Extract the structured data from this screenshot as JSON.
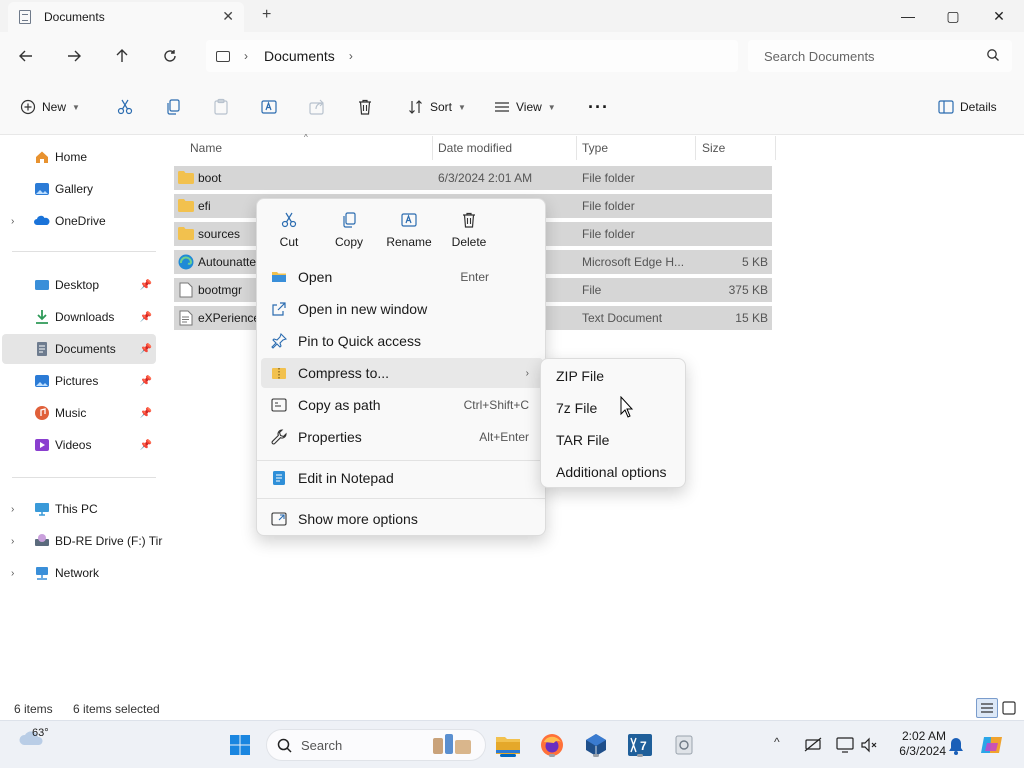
{
  "window": {
    "tab_title": "Documents",
    "new_tab": "+",
    "minimize": "—",
    "maximize": "▢",
    "close": "✕"
  },
  "address": {
    "crumb": "Documents",
    "separator": "›",
    "search_placeholder": "Search Documents"
  },
  "toolbar": {
    "new_label": "New",
    "sort_label": "Sort",
    "view_label": "View",
    "more_label": "···",
    "details_label": "Details"
  },
  "sidebar": {
    "quick": [
      {
        "label": "Home",
        "icon": "home-icon",
        "color": "#e8922f"
      },
      {
        "label": "Gallery",
        "icon": "gallery-icon",
        "color": "#2b7bd6"
      },
      {
        "label": "OneDrive",
        "icon": "onedrive-icon",
        "color": "#1a73d9"
      }
    ],
    "pinned": [
      {
        "label": "Desktop",
        "icon": "desktop-icon",
        "color": "#3a8fd9"
      },
      {
        "label": "Downloads",
        "icon": "downloads-icon",
        "color": "#2e9a58"
      },
      {
        "label": "Documents",
        "icon": "documents-icon",
        "color": "#6e7c8f"
      },
      {
        "label": "Pictures",
        "icon": "pictures-icon",
        "color": "#2b7bd6"
      },
      {
        "label": "Music",
        "icon": "music-icon",
        "color": "#e0603a"
      },
      {
        "label": "Videos",
        "icon": "videos-icon",
        "color": "#8a3fcf"
      }
    ],
    "devices": [
      {
        "label": "This PC",
        "icon": "this-pc-icon",
        "color": "#3a9ad9"
      },
      {
        "label": "BD-RE Drive (F:) Tir",
        "icon": "optical-drive-icon",
        "color": "#5b6b7d"
      },
      {
        "label": "Network",
        "icon": "network-icon",
        "color": "#3a8fd9"
      }
    ]
  },
  "files": {
    "columns": [
      "Name",
      "Date modified",
      "Type",
      "Size"
    ],
    "rows": [
      {
        "name": "boot",
        "date": "6/3/2024 2:01 AM",
        "type": "File folder",
        "size": "",
        "icon": "folder-icon"
      },
      {
        "name": "efi",
        "date": "",
        "type": "File folder",
        "size": "",
        "icon": "folder-icon"
      },
      {
        "name": "sources",
        "date": "",
        "type": "File folder",
        "size": "",
        "icon": "folder-icon"
      },
      {
        "name": "Autounatte",
        "date": "",
        "type": "Microsoft Edge H...",
        "size": "5 KB",
        "icon": "edge-html-icon"
      },
      {
        "name": "bootmgr",
        "date": "",
        "type": "File",
        "size": "375 KB",
        "icon": "file-icon"
      },
      {
        "name": "eXPerience",
        "date": "",
        "type": "Text Document",
        "size": "15 KB",
        "icon": "text-file-icon"
      }
    ]
  },
  "status": {
    "count": "6 items",
    "selected": "6 items selected"
  },
  "context_menu": {
    "quick_actions": [
      "Cut",
      "Copy",
      "Rename",
      "Delete"
    ],
    "items": [
      {
        "label": "Open",
        "shortcut": "Enter"
      },
      {
        "label": "Open in new window",
        "shortcut": ""
      },
      {
        "label": "Pin to Quick access",
        "shortcut": ""
      },
      {
        "label": "Compress to...",
        "shortcut": ""
      },
      {
        "label": "Copy as path",
        "shortcut": "Ctrl+Shift+C"
      },
      {
        "label": "Properties",
        "shortcut": "Alt+Enter"
      },
      {
        "label": "Edit in Notepad",
        "shortcut": ""
      },
      {
        "label": "Show more options",
        "shortcut": ""
      }
    ],
    "submenu_arrow": "›"
  },
  "submenu": {
    "items": [
      "ZIP File",
      "7z File",
      "TAR File",
      "Additional options"
    ]
  },
  "taskbar": {
    "weather": "63°",
    "search_label": "Search",
    "time": "2:02 AM",
    "date": "6/3/2024"
  },
  "colors": {
    "accent": "#0067c0",
    "selection": "#d6d6d6",
    "folder": "#f2c14e"
  }
}
